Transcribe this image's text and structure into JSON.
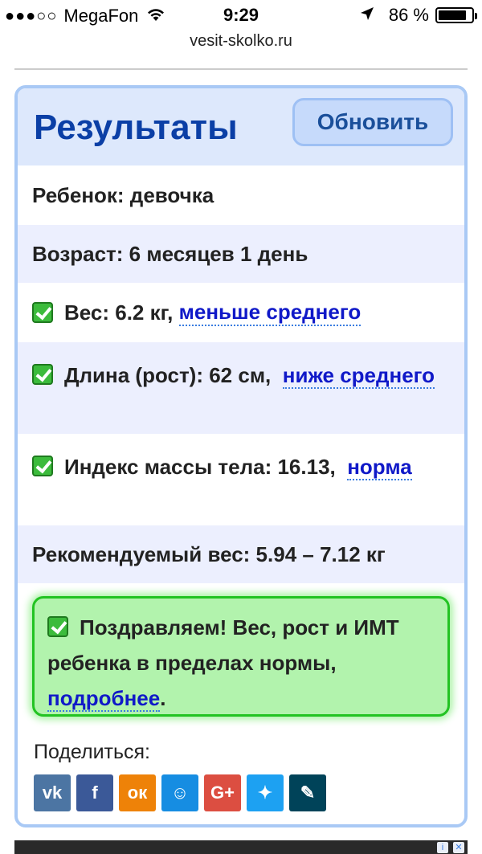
{
  "status_bar": {
    "signal": "●●●○○",
    "carrier": "MegaFon",
    "time": "9:29",
    "battery": "86 %",
    "battery_level": 0.86
  },
  "browser": {
    "url": "vesit-skolko.ru"
  },
  "results": {
    "title": "Результаты",
    "refresh_label": "Обновить",
    "child": "Ребенок: девочка",
    "age": "Возраст: 6 месяцев 1 день",
    "weight": {
      "text": "Вес: 6.2 кг,",
      "link": "меньше среднего"
    },
    "length": {
      "text": "Длина (рост): 62 см,",
      "link": "ниже среднего"
    },
    "bmi": {
      "text": "Индекс массы тела: 16.13,",
      "link": "норма"
    },
    "recommended": "Рекомендуемый вес: 5.94 – 7.12 кг",
    "congrats": {
      "text": "Поздравляем! Вес, рост и ИМТ ребенка в пределах нормы,",
      "link": "подробнее",
      "suffix": "."
    }
  },
  "share": {
    "label": "Поделиться:",
    "buttons": [
      {
        "icon": "vk-icon",
        "glyph": "vk",
        "color": "#4c75a3"
      },
      {
        "icon": "facebook-icon",
        "glyph": "f",
        "color": "#3b5998"
      },
      {
        "icon": "odnoklassniki-icon",
        "glyph": "ок",
        "color": "#ee8208"
      },
      {
        "icon": "moimir-icon",
        "glyph": "☺",
        "color": "#168de2"
      },
      {
        "icon": "googleplus-icon",
        "glyph": "G+",
        "color": "#dc4e41"
      },
      {
        "icon": "twitter-icon",
        "glyph": "✦",
        "color": "#1da1f2"
      },
      {
        "icon": "livejournal-icon",
        "glyph": "✎",
        "color": "#004359"
      }
    ]
  }
}
